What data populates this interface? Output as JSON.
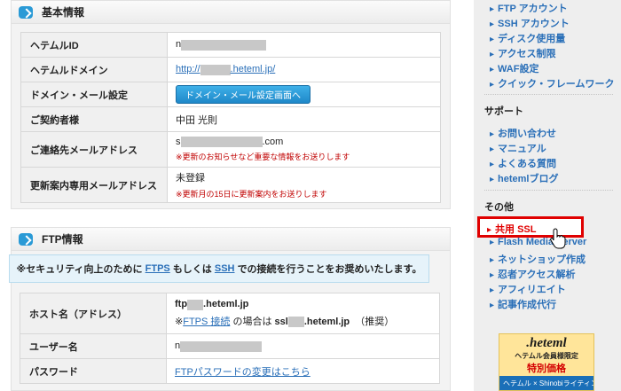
{
  "basic": {
    "title": "基本情報",
    "rows": [
      {
        "label": "ヘテムルID",
        "value_prefix": "n"
      },
      {
        "label": "ヘテムルドメイン",
        "link_prefix": "http://",
        "link_suffix": ".heteml.jp/"
      },
      {
        "label": "ドメイン・メール設定",
        "button": "ドメイン・メール設定画面へ"
      },
      {
        "label": "ご契約者様",
        "value": "中田 光則"
      },
      {
        "label": "ご連絡先メールアドレス",
        "value_prefix": "s",
        "value_suffix": ".com",
        "note": "※更新のお知らせなど重要な情報をお送りします"
      },
      {
        "label": "更新案内専用メールアドレス",
        "value": "未登録",
        "note": "※更新月の15日に更新案内をお送りします"
      }
    ]
  },
  "ftp": {
    "title": "FTP情報",
    "notice": {
      "before": "※セキュリティ向上のために",
      "link1": "FTPS",
      "middle": "もしくは",
      "link2": "SSH",
      "after": "での接続を行うことをお奨めいたします。"
    },
    "rows": [
      {
        "label": "ホスト名（アドレス）",
        "value_prefix": "ftp",
        "value_suffix": ".heteml.jp",
        "sub_prefix": "※",
        "sub_link": "FTPS 接続",
        "sub_mid": "の場合は",
        "sub_host_prefix": "ssl",
        "sub_host_suffix": ".heteml.jp",
        "sub_tail": "（推奨）"
      },
      {
        "label": "ユーザー名",
        "value_prefix": "n"
      },
      {
        "label": "パスワード",
        "link": "FTPパスワードの変更はこちら"
      }
    ]
  },
  "sidebar": {
    "top_items": [
      "FTP アカウント",
      "SSH アカウント",
      "ディスク使用量",
      "アクセス制限",
      "WAF設定",
      "クイック・フレームワーク"
    ],
    "support_title": "サポート",
    "support_items": [
      "お問い合わせ",
      "マニュアル",
      "よくある質問",
      "hetemlブログ"
    ],
    "other_title": "その他",
    "other_items": [
      "共用 SSL",
      "Flash Media Server",
      "ネットショップ作成",
      "忍者アクセス解析",
      "アフィリエイト",
      "記事作成代行"
    ]
  },
  "banner": {
    "logo": ".heteml",
    "line1": "ヘテムル会員様限定",
    "line2": "特別価格",
    "line3": "ヘテムル × Shinobiライティング"
  },
  "colors": {
    "accent": "#2a9ad6",
    "link": "#2a6fb8",
    "highlight": "#e00000",
    "note": "#c00000"
  }
}
